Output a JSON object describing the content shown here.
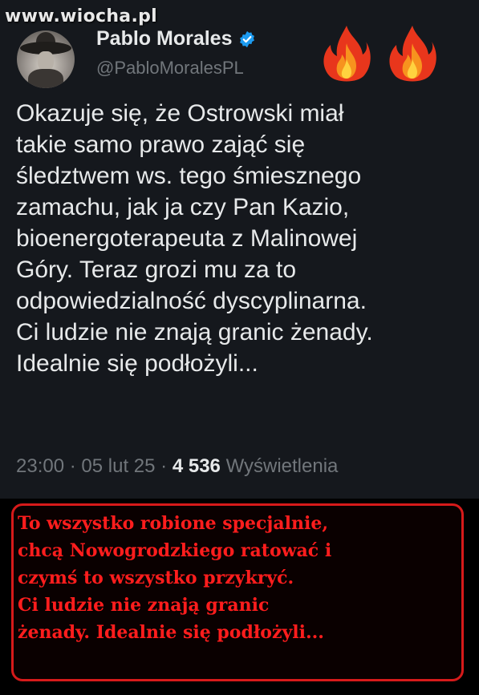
{
  "watermark": "www.wiocha.pl",
  "tweet": {
    "author_name": "Pablo Morales",
    "handle": "@PabloMoralesPL",
    "lines": [
      "Okazuje się, że Ostrowski miał",
      "takie samo prawo zająć się",
      "śledztwem ws. tego śmiesznego",
      "zamachu, jak ja czy Pan Kazio,",
      "bioenergoterapeuta z Malinowej",
      "Góry. Teraz grozi mu za to",
      "odpowiedzialność dyscyplinarna.",
      "Ci ludzie nie znają granic żenady.",
      "Idealnie się podłożyli..."
    ],
    "time": "23:00",
    "date": "05 lut 25",
    "views_count": "4 536",
    "views_label": "Wyświetlenia",
    "separator": "·"
  },
  "caption": {
    "lines": [
      "To wszystko robione specjalnie,",
      "chcą Nowogrodzkiego ratować i",
      "czymś to wszystko przykryć.",
      "Ci ludzie nie znają granic",
      "żenady. Idealnie się podłożyli..."
    ]
  },
  "icons": {
    "verified": "verified-badge-icon",
    "fire": "fire-emoji-icon"
  },
  "colors": {
    "background": "#15181d",
    "verified_blue": "#1d9bf0",
    "caption_red": "#ff1d1d"
  }
}
